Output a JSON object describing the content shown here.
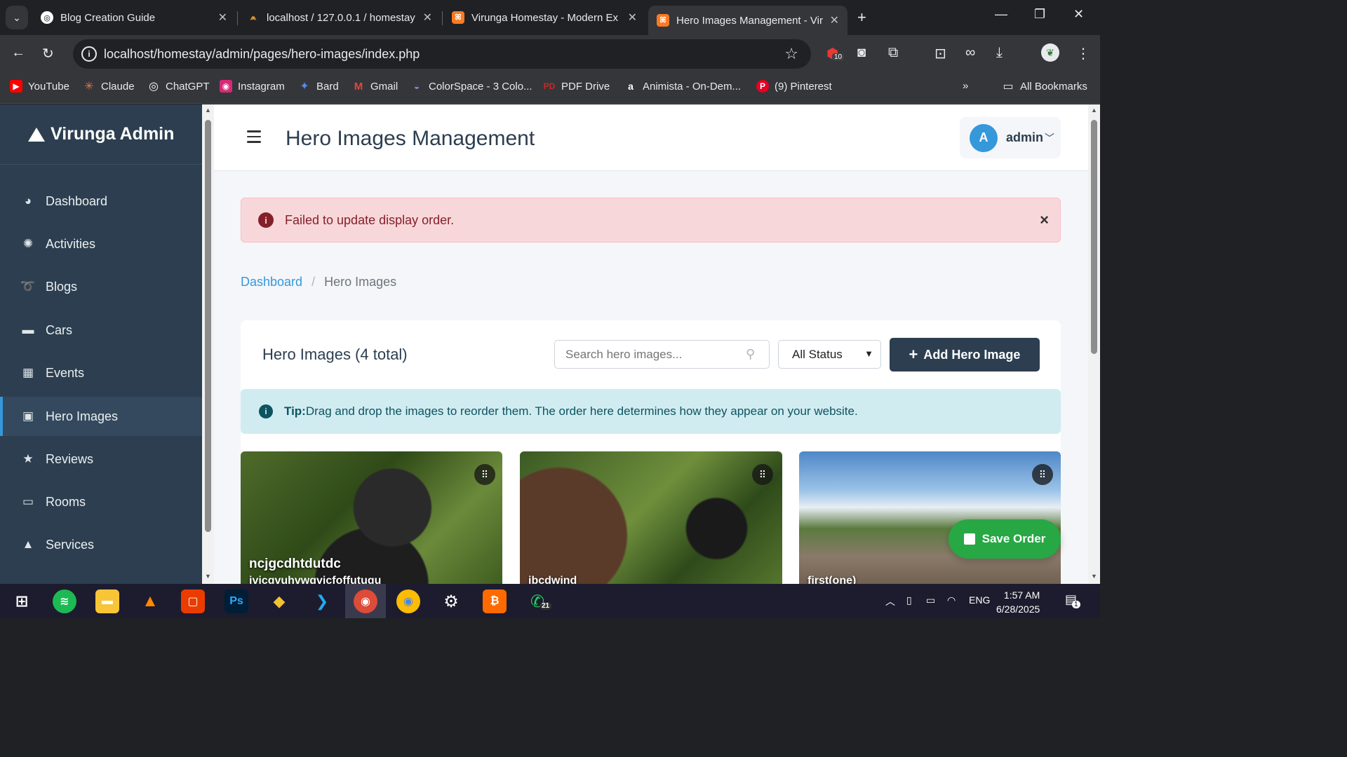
{
  "browser": {
    "tabs": [
      {
        "title": "Blog Creation Guide",
        "icon": "openai-icon"
      },
      {
        "title": "localhost / 127.0.0.1 / homestay",
        "icon": "phpmyadmin-icon"
      },
      {
        "title": "Virunga Homestay - Modern Ex",
        "icon": "xampp-icon"
      },
      {
        "title": "Hero Images Management - Vir",
        "icon": "xampp-icon"
      }
    ],
    "url": "localhost/homestay/admin/pages/hero-images/index.php",
    "extension_badge": "10",
    "bookmarks": [
      {
        "label": "YouTube",
        "icon": "youtube-icon"
      },
      {
        "label": "Claude",
        "icon": "claude-icon"
      },
      {
        "label": "ChatGPT",
        "icon": "chatgpt-icon"
      },
      {
        "label": "Instagram",
        "icon": "instagram-icon"
      },
      {
        "label": "Bard",
        "icon": "bard-icon"
      },
      {
        "label": "Gmail",
        "icon": "gmail-icon"
      },
      {
        "label": "ColorSpace - 3 Colo...",
        "icon": "colorspace-icon"
      },
      {
        "label": "PDF Drive",
        "icon": "pdfdrive-icon"
      },
      {
        "label": "Animista - On-Dem...",
        "icon": "animista-icon"
      },
      {
        "label": "(9) Pinterest",
        "icon": "pinterest-icon"
      }
    ],
    "all_bookmarks": "All Bookmarks"
  },
  "sidebar": {
    "brand": "Virunga Admin",
    "items": [
      {
        "label": "Dashboard",
        "icon": "gauge-icon",
        "glyph": "◕"
      },
      {
        "label": "Activities",
        "icon": "hiking-icon",
        "glyph": "✺"
      },
      {
        "label": "Blogs",
        "icon": "blog-icon",
        "glyph": "➰"
      },
      {
        "label": "Cars",
        "icon": "car-icon",
        "glyph": "▬"
      },
      {
        "label": "Events",
        "icon": "calendar-icon",
        "glyph": "▦"
      },
      {
        "label": "Hero Images",
        "icon": "images-icon",
        "glyph": "▣"
      },
      {
        "label": "Reviews",
        "icon": "star-icon",
        "glyph": "★"
      },
      {
        "label": "Rooms",
        "icon": "bed-icon",
        "glyph": "▭"
      },
      {
        "label": "Services",
        "icon": "bell-icon",
        "glyph": "▲"
      }
    ],
    "active_index": 5
  },
  "header": {
    "title": "Hero Images Management",
    "user_initial": "A",
    "user_name": "admin"
  },
  "alert": {
    "message": "Failed to update display order.",
    "close": "×"
  },
  "breadcrumb": {
    "home": "Dashboard",
    "current": "Hero Images"
  },
  "card": {
    "title": "Hero Images (4 total)",
    "search_placeholder": "Search hero images...",
    "status_value": "All Status",
    "add_button": "Add Hero Image",
    "tip_label": "Tip:",
    "tip_text": "Drag and drop the images to reorder them. The order here determines how they appear on your website.",
    "images": [
      {
        "title": "ncjgcdhtdutdc",
        "subtitle": "jvjcgvuhvwgvjcfoffutugu"
      },
      {
        "title": "",
        "subtitle": "jbcdwjnd"
      },
      {
        "title": "",
        "subtitle": "first(one)"
      }
    ],
    "save_order": "Save Order"
  },
  "taskbar": {
    "apps": [
      {
        "name": "start-icon"
      },
      {
        "name": "spotify-icon"
      },
      {
        "name": "file-explorer-icon"
      },
      {
        "name": "vlc-icon"
      },
      {
        "name": "office-icon"
      },
      {
        "name": "photoshop-icon"
      },
      {
        "name": "git-icon"
      },
      {
        "name": "vscode-icon"
      },
      {
        "name": "chrome-profile-icon"
      },
      {
        "name": "chrome-icon"
      },
      {
        "name": "settings-icon"
      },
      {
        "name": "sublime-icon"
      },
      {
        "name": "whatsapp-icon"
      }
    ],
    "whatsapp_badge": "21",
    "language": "ENG",
    "time": "1:57 AM",
    "date": "6/28/2025",
    "notification_badge": "1"
  }
}
